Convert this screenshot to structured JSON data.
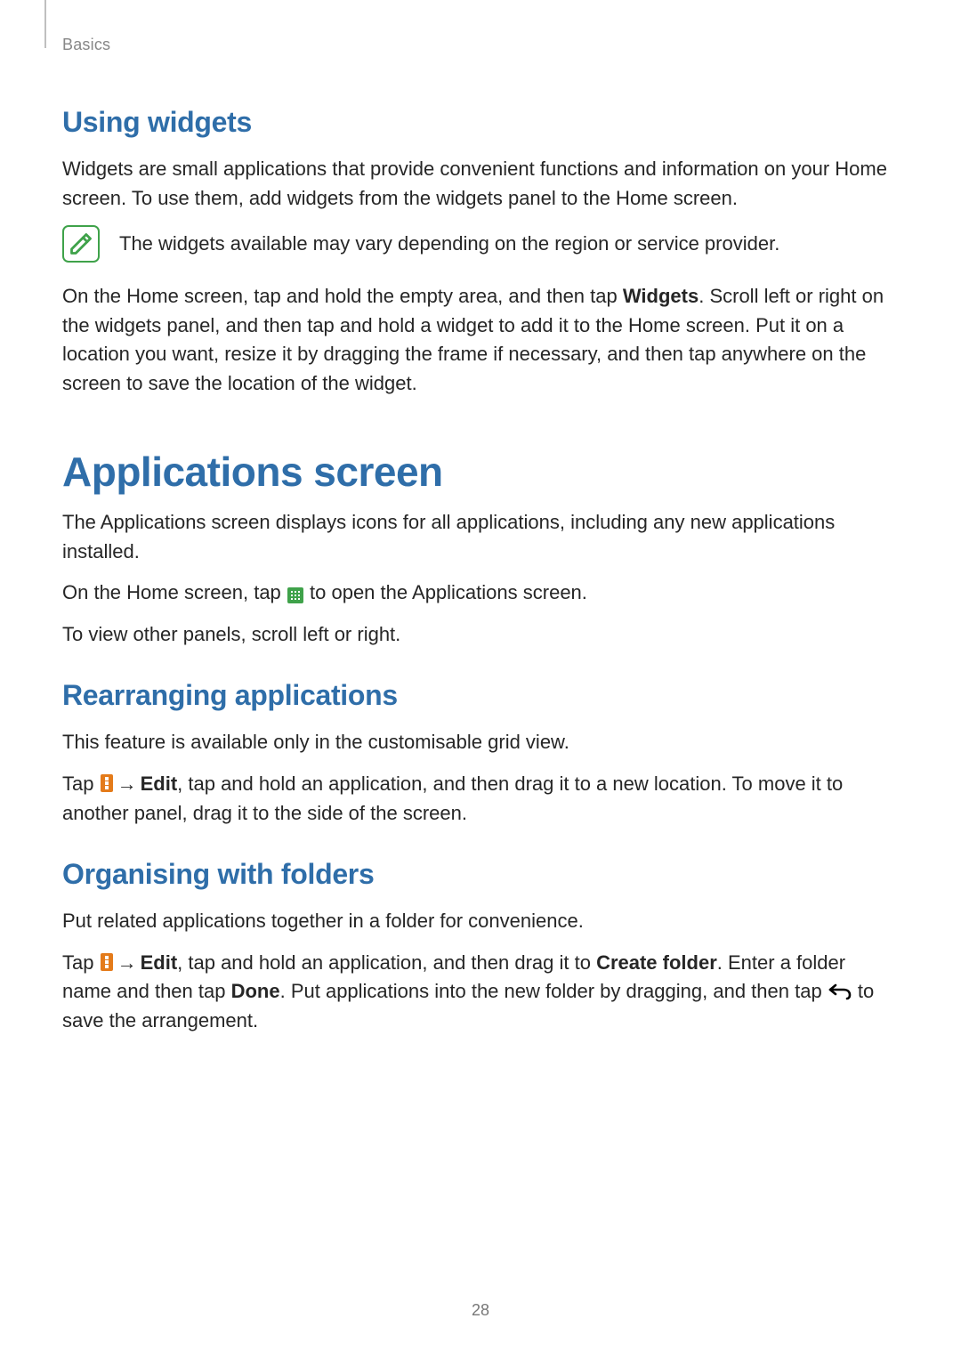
{
  "breadcrumb": "Basics",
  "sections": {
    "widgets": {
      "heading": "Using widgets",
      "p1": "Widgets are small applications that provide convenient functions and information on your Home screen. To use them, add widgets from the widgets panel to the Home screen.",
      "note": "The widgets available may vary depending on the region or service provider.",
      "p2_a": "On the Home screen, tap and hold the empty area, and then tap ",
      "p2_bold": "Widgets",
      "p2_b": ". Scroll left or right on the widgets panel, and then tap and hold a widget to add it to the Home screen. Put it on a location you want, resize it by dragging the frame if necessary, and then tap anywhere on the screen to save the location of the widget."
    },
    "apps": {
      "heading": "Applications screen",
      "p1": "The Applications screen displays icons for all applications, including any new applications installed.",
      "p2_a": "On the Home screen, tap ",
      "p2_b": " to open the Applications screen.",
      "p3": "To view other panels, scroll left or right."
    },
    "rearr": {
      "heading": "Rearranging applications",
      "p1": "This feature is available only in the customisable grid view.",
      "p2_a": "Tap ",
      "arrow": "→",
      "edit": "Edit",
      "p2_b": ", tap and hold an application, and then drag it to a new location. To move it to another panel, drag it to the side of the screen."
    },
    "org": {
      "heading": "Organising with folders",
      "p1": "Put related applications together in a folder for convenience.",
      "p2_a": "Tap ",
      "arrow": "→",
      "edit": "Edit",
      "p2_b": ", tap and hold an application, and then drag it to ",
      "create": "Create folder",
      "p2_c": ". Enter a folder name and then tap ",
      "done": "Done",
      "p2_d": ". Put applications into the new folder by dragging, and then tap ",
      "p2_e": " to save the arrangement."
    }
  },
  "page_number": "28"
}
